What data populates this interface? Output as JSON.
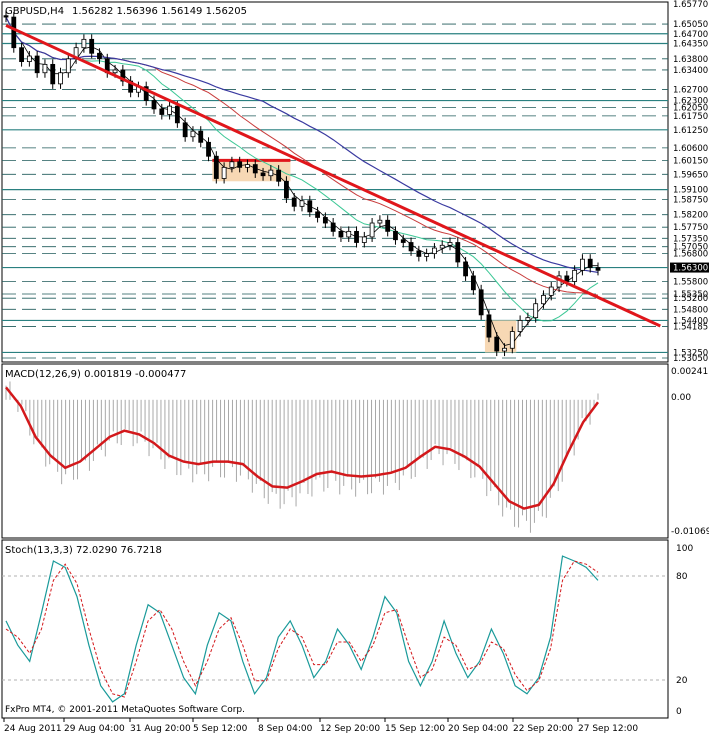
{
  "main": {
    "symbol_label": "GBPUSD,H4",
    "ohlc_label": "1.56282 1.56396 1.56149 1.56205",
    "price_levels": [
      "1.65770",
      "1.65050",
      "1.64700",
      "1.64350",
      "1.63800",
      "1.63400",
      "1.62700",
      "1.62300",
      "1.62050",
      "1.61750",
      "1.61250",
      "1.60600",
      "1.60150",
      "1.59650",
      "1.59100",
      "1.58750",
      "1.58200",
      "1.57750",
      "1.57350",
      "1.57050",
      "1.56800",
      "1.56300",
      "1.55800",
      "1.55350",
      "1.55200",
      "1.54800",
      "1.54400",
      "1.54185",
      "1.53250",
      "1.53050"
    ],
    "highlighted_levels": [
      "1.64700",
      "1.64350",
      "1.62300",
      "1.61250",
      "1.59100",
      "1.56300",
      "1.54400",
      "1.53250"
    ],
    "current_price": "1.56300",
    "colors": {
      "candles": "#000000",
      "trendline": "#e0161b",
      "boxes": "#f7d8b4",
      "ma_fast": "#000000",
      "ma_green": "#3cc896",
      "ma_red": "#c83c3c",
      "ma_blue": "#3a3aa0",
      "levels": "#2a8080"
    }
  },
  "macd": {
    "label": "MACD(12,26,9) 0.001819 -0.000477",
    "ticks": [
      "0.00241",
      "0.00",
      "-0.01069"
    ]
  },
  "stoch": {
    "label": "Stoch(13,3,3) 72.0290 76.7218",
    "ticks": [
      "100",
      "80",
      "20",
      "0"
    ]
  },
  "copyright": "FxPro MT4, © 2001-2011 MetaQuotes Software Corp.",
  "time_axis": [
    "24 Aug 2011",
    "29 Aug 04:00",
    "31 Aug 20:00",
    "5 Sep 12:00",
    "8 Sep 04:00",
    "12 Sep 20:00",
    "15 Sep 12:00",
    "20 Sep 04:00",
    "22 Sep 20:00",
    "27 Sep 12:00"
  ],
  "chart_data": {
    "type": "line",
    "close_prices_approx": [
      1.653,
      1.642,
      1.637,
      1.639,
      1.633,
      1.636,
      1.629,
      1.633,
      1.638,
      1.642,
      1.645,
      1.64,
      1.638,
      1.633,
      1.634,
      1.63,
      1.626,
      1.628,
      1.623,
      1.62,
      1.618,
      1.621,
      1.615,
      1.61,
      1.612,
      1.608,
      1.603,
      1.595,
      1.599,
      1.601,
      1.599,
      1.6,
      1.597,
      1.596,
      1.598,
      1.594,
      1.588,
      1.585,
      1.587,
      1.583,
      1.581,
      1.579,
      1.576,
      1.574,
      1.576,
      1.572,
      1.574,
      1.579,
      1.58,
      1.576,
      1.573,
      1.572,
      1.569,
      1.567,
      1.568,
      1.57,
      1.571,
      1.572,
      1.565,
      1.56,
      1.555,
      1.546,
      1.538,
      1.533,
      1.534,
      1.54,
      1.544,
      1.545,
      1.55,
      1.553,
      1.556,
      1.56,
      1.558,
      1.562,
      1.566,
      1.563,
      1.562
    ],
    "ylim": [
      1.5305,
      1.6577
    ],
    "resistance_box": {
      "from_index": 27,
      "to_index": 36,
      "low": 1.594,
      "high": 1.6015
    },
    "support_box": {
      "from_index": 62,
      "to_index": 65,
      "low": 1.5325,
      "high": 1.544
    },
    "trendline": {
      "start": [
        0,
        1.65
      ],
      "end": [
        84,
        1.542
      ]
    },
    "macd_series": {
      "name": "MACD",
      "values": [
        0.001,
        -0.0005,
        -0.003,
        -0.0045,
        -0.0055,
        -0.005,
        -0.004,
        -0.003,
        -0.0025,
        -0.0028,
        -0.0035,
        -0.0045,
        -0.005,
        -0.0052,
        -0.005,
        -0.005,
        -0.0052,
        -0.0062,
        -0.007,
        -0.0071,
        -0.0066,
        -0.006,
        -0.0058,
        -0.0061,
        -0.0062,
        -0.0061,
        -0.0059,
        -0.0055,
        -0.0046,
        -0.0038,
        -0.004,
        -0.0046,
        -0.0054,
        -0.0068,
        -0.0082,
        -0.0088,
        -0.0085,
        -0.0068,
        -0.0042,
        -0.0018,
        -0.0002
      ]
    },
    "stoch_main": {
      "name": "Main",
      "values": [
        55,
        40,
        30,
        60,
        92,
        88,
        70,
        40,
        15,
        5,
        10,
        40,
        65,
        60,
        40,
        20,
        10,
        40,
        60,
        55,
        30,
        10,
        20,
        45,
        55,
        40,
        20,
        30,
        50,
        40,
        25,
        45,
        70,
        60,
        30,
        15,
        30,
        55,
        35,
        20,
        30,
        50,
        35,
        15,
        10,
        20,
        45,
        95,
        92,
        88,
        80
      ]
    },
    "stoch_signal": {
      "name": "Signal",
      "values": [
        50,
        45,
        35,
        50,
        80,
        90,
        78,
        50,
        25,
        10,
        8,
        30,
        55,
        62,
        50,
        30,
        15,
        30,
        50,
        57,
        40,
        18,
        18,
        38,
        50,
        45,
        28,
        28,
        42,
        42,
        30,
        40,
        60,
        62,
        40,
        20,
        25,
        45,
        40,
        25,
        28,
        42,
        38,
        22,
        12,
        18,
        38,
        80,
        92,
        90,
        85
      ]
    }
  }
}
